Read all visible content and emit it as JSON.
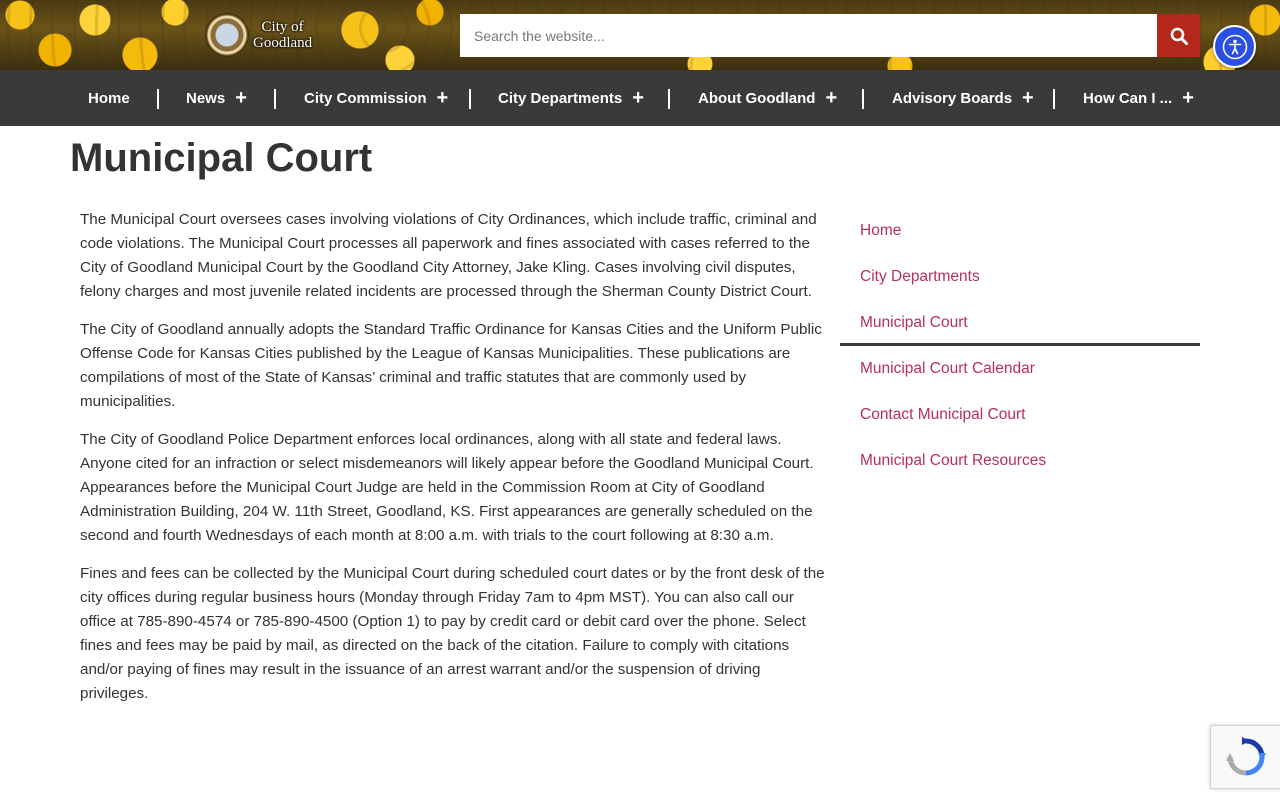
{
  "header": {
    "logo_line1": "City of",
    "logo_line2": "Goodland",
    "search_placeholder": "Search the website...",
    "search_icon": "search-icon",
    "accessibility_icon": "accessibility-icon"
  },
  "nav": {
    "items": [
      {
        "label": "Home"
      },
      {
        "label": "News",
        "plus": "+"
      },
      {
        "label": "City Commission",
        "plus": "+"
      },
      {
        "label": "City Departments",
        "plus": "+"
      },
      {
        "label": "About Goodland",
        "plus": "+"
      },
      {
        "label": "Advisory Boards",
        "plus": "+"
      },
      {
        "label": "How Can I ...",
        "plus": "+"
      }
    ]
  },
  "page": {
    "title": "Municipal Court",
    "paragraphs": [
      "The Municipal Court oversees cases involving violations of City Ordinances, which include traffic, criminal and code violations. The Municipal Court processes all paperwork and fines associated with cases referred to the City of Goodland Municipal Court by the Goodland City Attorney, Jake Kling. Cases involving civil disputes, felony charges and most juvenile related incidents are processed through the Sherman County District Court.",
      "The City of Goodland annually adopts the Standard Traffic Ordinance for Kansas Cities and the Uniform Public Offense Code for Kansas Cities published by the League of Kansas Municipalities. These publications are compilations of most of the State of Kansas’ criminal and traffic statutes that are commonly used by municipalities.",
      "The City of Goodland Police Department enforces local ordinances, along with all state and federal laws. Anyone cited for an infraction or select misdemeanors will likely appear before the Goodland Municipal Court. Appearances before the Municipal Court Judge are held in the Commission Room at City of Goodland Administration Building, 204 W. 11th Street, Goodland, KS. First appearances are generally scheduled on the second and fourth Wednesdays of each month at 8:00 a.m. with trials to the court following at 8:30 a.m.",
      "Fines and fees can be collected by the Municipal Court during scheduled court dates or by the front desk of the city offices during regular business hours (Monday through Friday 7am to 4pm MST). You can also call our office at 785-890-4574 or 785-890-4500 (Option 1) to pay by credit card or debit card over the phone.  Select fines and fees may be paid by mail, as directed on the back of the citation. Failure to comply with citations and/or paying of fines may result in the issuance of an arrest warrant and/or the suspension of driving privileges."
    ]
  },
  "sidebar": {
    "items": [
      {
        "label": "Home"
      },
      {
        "label": "City Departments"
      },
      {
        "label": "Municipal Court",
        "active": true
      },
      {
        "label": "Municipal Court Calendar"
      },
      {
        "label": "Contact Municipal Court"
      },
      {
        "label": "Municipal Court Resources"
      }
    ]
  },
  "colors": {
    "nav_bg": "#3a3a3a",
    "link": "#b5305a",
    "search_button": "#b5271b",
    "accessibility_button": "#2b4fe0"
  }
}
